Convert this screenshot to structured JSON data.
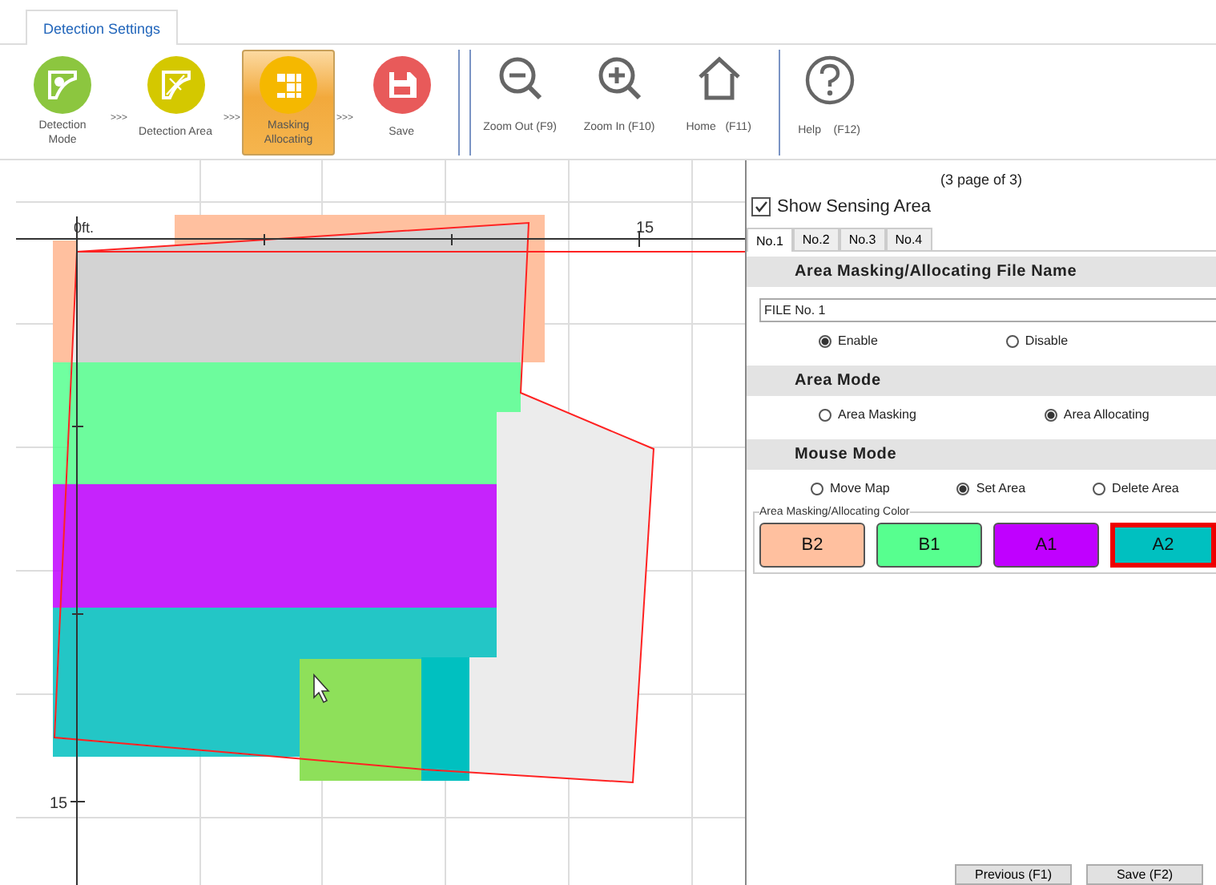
{
  "tab": {
    "label": "Detection Settings",
    "selected": true
  },
  "steps": [
    {
      "label": "Detection\nMode",
      "kind": "mode",
      "selected": false,
      "arrow": ">>>"
    },
    {
      "label": "Detection Area",
      "kind": "area",
      "selected": false,
      "arrow": ">>>"
    },
    {
      "label": "Masking\nAllocating",
      "kind": "masking",
      "selected": true,
      "arrow": ">>>"
    },
    {
      "label": "Save",
      "kind": "save",
      "selected": false
    }
  ],
  "tools": [
    {
      "label": "Zoom Out (F9)",
      "kind": "zoom-out"
    },
    {
      "label": "Zoom In (F10)",
      "kind": "zoom-in"
    },
    {
      "label": "Home   (F11)",
      "kind": "home"
    }
  ],
  "help": {
    "label": "Help    (F12)"
  },
  "map": {
    "origin_label": "0ft.",
    "x_label": "15",
    "y_label": "15"
  },
  "panel": {
    "page": "(3 page of 3)",
    "show_sensing_area": {
      "label": "Show Sensing Area",
      "checked": true
    },
    "tabs": [
      {
        "label": "No.1",
        "selected": true
      },
      {
        "label": "No.2",
        "selected": false
      },
      {
        "label": "No.3",
        "selected": false
      },
      {
        "label": "No.4",
        "selected": false
      }
    ],
    "sections": [
      {
        "title": "Area Masking/Allocating File Name",
        "field": "FILE No. 1",
        "options": [
          {
            "label": "Enable",
            "selected": true
          },
          {
            "label": "Disable",
            "selected": false
          }
        ]
      },
      {
        "title": "Area Mode",
        "options": [
          {
            "label": "Area Masking",
            "selected": false
          },
          {
            "label": "Area Allocating",
            "selected": true
          }
        ]
      },
      {
        "title": "Mouse Mode",
        "options": [
          {
            "label": "Move Map",
            "selected": false
          },
          {
            "label": "Set Area",
            "selected": true
          },
          {
            "label": "Delete Area",
            "selected": false
          }
        ]
      }
    ],
    "color_group": {
      "legend": "Area Masking/Allocating Color",
      "colors": [
        {
          "label": "B2",
          "color": "#ffc09f",
          "selected": false
        },
        {
          "label": "B1",
          "color": "#57ff8f",
          "selected": false
        },
        {
          "label": "A1",
          "color": "#c000ff",
          "selected": false
        },
        {
          "label": "A2",
          "color": "#00c0c0",
          "selected": true
        }
      ]
    },
    "buttons": [
      "Previous (F1)",
      "Save (F2)"
    ]
  }
}
